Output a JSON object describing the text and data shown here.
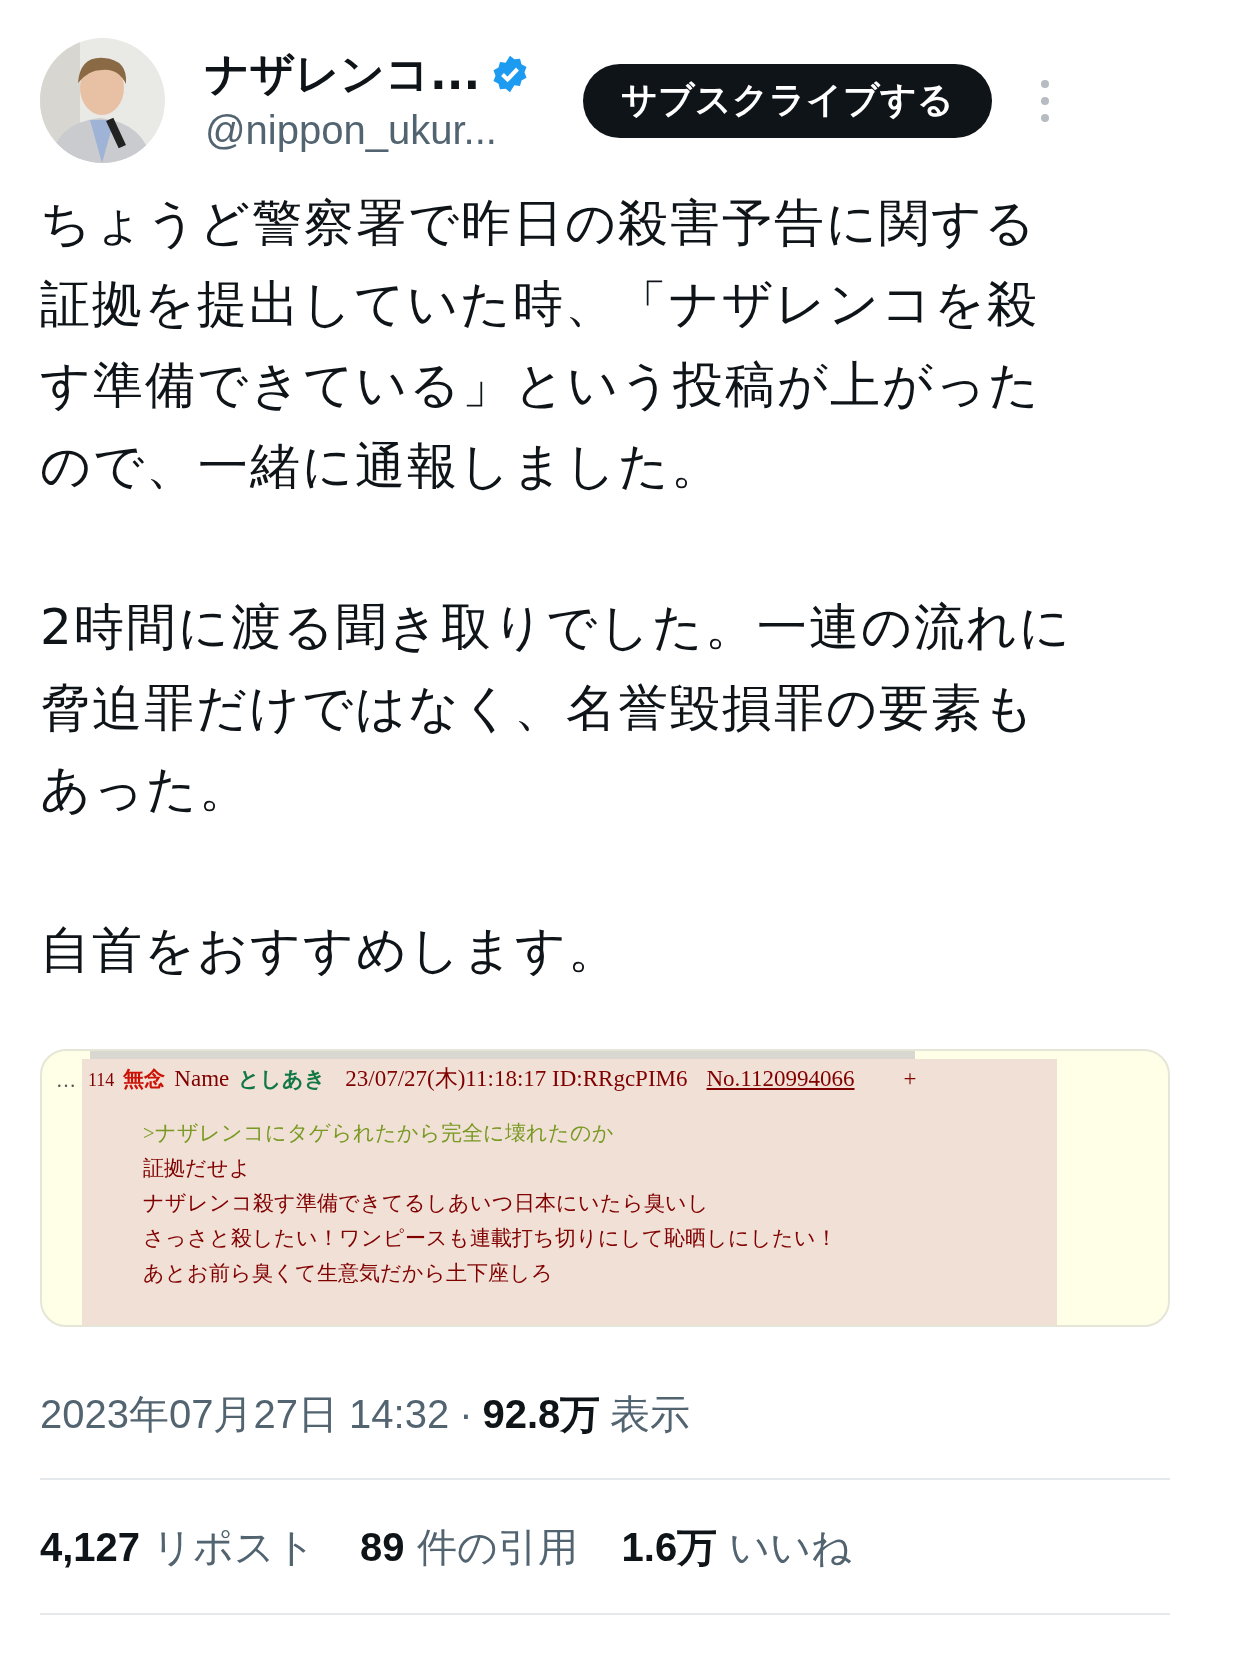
{
  "author": {
    "name": "ナザレンコ...",
    "verified": true,
    "handle": "@nippon_ukur..."
  },
  "subscribe_button": "サブスクライブする",
  "paragraphs": [
    "ちょうど警察署で昨日の殺害予告に関する証拠を提出していた時、「ナザレンコを殺す準備できている」という投稿が上がったので、一緒に通報しました。",
    "2時間に渡る聞き取りでした。一連の流れに脅迫罪だけではなく、名誉毀損罪の要素もあった。",
    "自首をおすすめします。"
  ],
  "embedded_post": {
    "menu": "…",
    "number": "114",
    "subject": "無念",
    "name_label": "Name",
    "name": "としあき",
    "date": "23/07/27(木)11:18:17 ID:RRgcPIM6",
    "post_no": "No.1120994066",
    "plus": "+",
    "lines": [
      {
        "kind": "quote",
        "text": ">ナザレンコにタゲられたから完全に壊れたのか"
      },
      {
        "kind": "plain",
        "text": "証拠だせよ"
      },
      {
        "kind": "plain",
        "text": "ナザレンコ殺す準備できてるしあいつ日本にいたら臭いし"
      },
      {
        "kind": "plain",
        "text": "さっさと殺したい！ワンピースも連載打ち切りにして恥晒しにしたい！"
      },
      {
        "kind": "plain",
        "text": "あとお前ら臭くて生意気だから土下座しろ"
      }
    ]
  },
  "timestamp": "2023年07月27日 14:32",
  "separator": "·",
  "views": {
    "count": "92.8万",
    "label": "表示"
  },
  "stats": [
    {
      "count": "4,127",
      "label": "リポスト"
    },
    {
      "count": "89",
      "label": "件の引用"
    },
    {
      "count": "1.6万",
      "label": "いいね"
    }
  ]
}
